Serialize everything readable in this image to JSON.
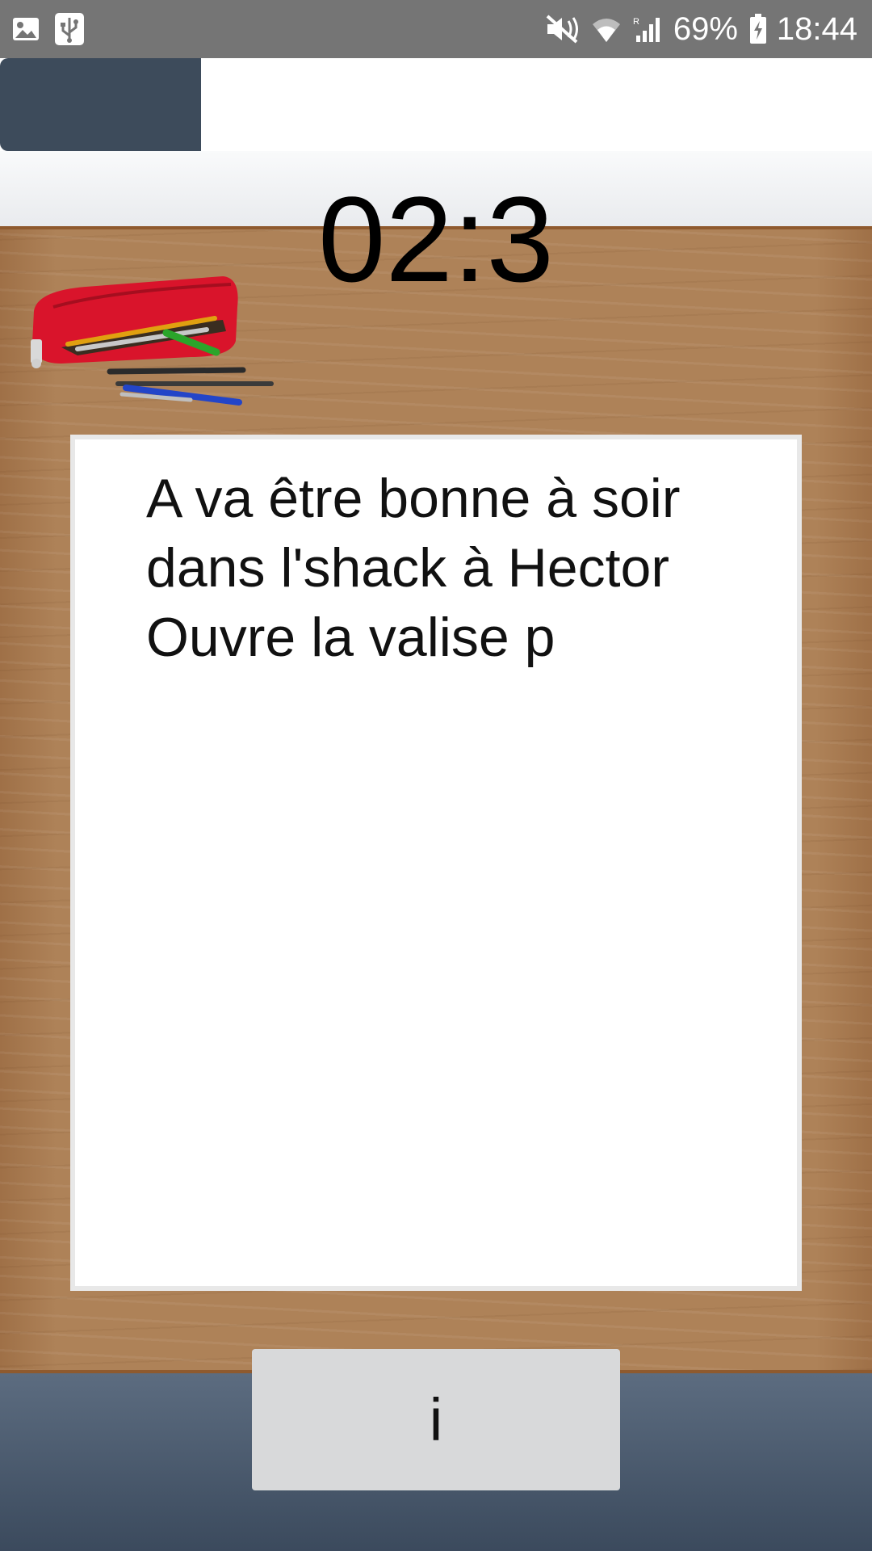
{
  "status_bar": {
    "icons_left": [
      "image-icon",
      "usb-icon"
    ],
    "icons_right": [
      "mute-icon",
      "wifi-icon",
      "signal-icon"
    ],
    "battery_percent": "69%",
    "battery_icon": "battery-charging-icon",
    "time": "18:44"
  },
  "timer": {
    "value": "02:3"
  },
  "note": {
    "text": "A va être bonne à soir\ndans l'shack à Hector\nOuvre la valise p"
  },
  "info_button": {
    "label": "i"
  },
  "colors": {
    "status_bar_bg": "#757575",
    "header_block": "#3d4b5b",
    "wood": "#ae8258",
    "bottom_bar": "#4b5a6e",
    "button_bg": "#d8d9da"
  }
}
